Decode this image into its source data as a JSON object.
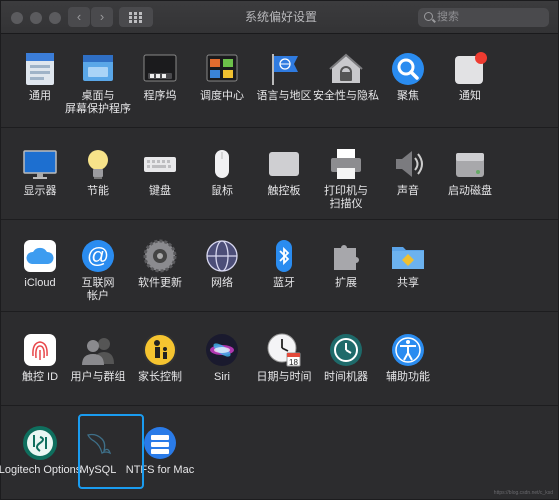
{
  "window": {
    "title": "系统偏好设置",
    "search_placeholder": "搜索",
    "back": "‹",
    "forward": "›"
  },
  "rows": [
    [
      {
        "label": "通用",
        "icon": "file-doc-icon"
      },
      {
        "label": "桌面与\n屏幕保护程序",
        "icon": "desktop-icon"
      },
      {
        "label": "程序坞",
        "icon": "dock-icon"
      },
      {
        "label": "调度中心",
        "icon": "mission-control-icon"
      },
      {
        "label": "语言与地区",
        "icon": "flag-icon"
      },
      {
        "label": "安全性与隐私",
        "icon": "house-lock-icon"
      },
      {
        "label": "聚焦",
        "icon": "spotlight-icon"
      },
      {
        "label": "通知",
        "icon": "notification-icon"
      }
    ],
    [
      {
        "label": "显示器",
        "icon": "display-icon"
      },
      {
        "label": "节能",
        "icon": "lightbulb-icon"
      },
      {
        "label": "键盘",
        "icon": "keyboard-icon"
      },
      {
        "label": "鼠标",
        "icon": "mouse-icon"
      },
      {
        "label": "触控板",
        "icon": "trackpad-icon"
      },
      {
        "label": "打印机与\n扫描仪",
        "icon": "printer-icon"
      },
      {
        "label": "声音",
        "icon": "speaker-icon"
      },
      {
        "label": "启动磁盘",
        "icon": "disk-icon"
      }
    ],
    [
      {
        "label": "iCloud",
        "icon": "cloud-icon"
      },
      {
        "label": "互联网\n帐户",
        "icon": "at-icon"
      },
      {
        "label": "软件更新",
        "icon": "gear-icon"
      },
      {
        "label": "网络",
        "icon": "globe-icon"
      },
      {
        "label": "蓝牙",
        "icon": "bluetooth-icon"
      },
      {
        "label": "扩展",
        "icon": "puzzle-icon"
      },
      {
        "label": "共享",
        "icon": "folder-share-icon"
      }
    ],
    [
      {
        "label": "触控 ID",
        "icon": "fingerprint-icon"
      },
      {
        "label": "用户与群组",
        "icon": "users-icon"
      },
      {
        "label": "家长控制",
        "icon": "parental-icon"
      },
      {
        "label": "Siri",
        "icon": "siri-icon"
      },
      {
        "label": "日期与时间",
        "icon": "clock-calendar-icon"
      },
      {
        "label": "时间机器",
        "icon": "time-machine-icon"
      },
      {
        "label": "辅助功能",
        "icon": "accessibility-icon"
      }
    ],
    [
      {
        "label": "Logitech Options",
        "icon": "logitech-icon"
      },
      {
        "label": "MySQL",
        "icon": "mysql-dolphin-icon",
        "selected": true
      },
      {
        "label": "NTFS for Mac",
        "icon": "ntfs-drive-icon"
      }
    ]
  ],
  "watermark": "https://blog.csdn.net/c_ksd"
}
